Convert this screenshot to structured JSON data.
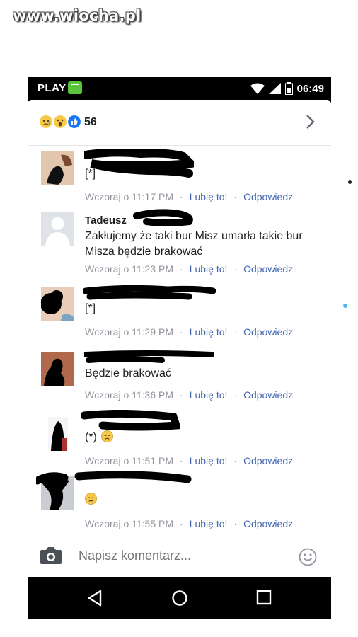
{
  "watermark": "www.wiocha.pl",
  "status_bar": {
    "carrier": "PLAY",
    "time": "06:49",
    "icons": [
      "wifi-icon",
      "signal-icon",
      "battery-icon"
    ]
  },
  "reactions": {
    "icons": [
      "sad-emoji-icon",
      "wow-emoji-icon",
      "like-icon"
    ],
    "count": "56"
  },
  "comments": [
    {
      "name": "",
      "text": "[*]",
      "time": "Wczoraj o 11:17 PM",
      "like": "Lubię to!",
      "reply": "Odpowiedz"
    },
    {
      "name": "Tadeusz",
      "text": "Zakłujemy że taki bur Misz umarła takie bur Misza będzie brakować",
      "time": "Wczoraj o 11:23 PM",
      "like": "Lubię to!",
      "reply": "Odpowiedz"
    },
    {
      "name": "",
      "text": "[*]",
      "time": "Wczoraj o 11:29 PM",
      "like": "Lubię to!",
      "reply": "Odpowiedz"
    },
    {
      "name": "",
      "text": "Będzie brakować",
      "time": "Wczoraj o 11:36 PM",
      "like": "Lubię to!",
      "reply": "Odpowiedz"
    },
    {
      "name": "",
      "text": "(*)",
      "time": "Wczoraj o 11:51 PM",
      "like": "Lubię to!",
      "reply": "Odpowiedz"
    },
    {
      "name": "",
      "text": "",
      "time": "Wczoraj o 11:55 PM",
      "like": "Lubię to!",
      "reply": "Odpowiedz"
    }
  ],
  "composer": {
    "placeholder": "Napisz komentarz..."
  },
  "nav": {
    "icons": [
      "back-icon",
      "home-icon",
      "recents-icon"
    ]
  },
  "colors": {
    "link": "#4267b2",
    "meta": "#90949c",
    "like": "#1877f2",
    "emoji": "#f7c948"
  }
}
